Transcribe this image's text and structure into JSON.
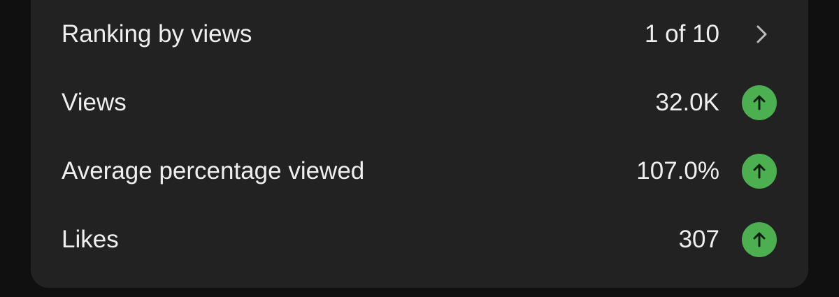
{
  "colors": {
    "background": "#101010",
    "card": "#222222",
    "text": "#efefef",
    "up_badge": "#4caf50",
    "up_arrow": "#0d1f0f"
  },
  "rows": [
    {
      "label": "Ranking by views",
      "value": "1 of 10",
      "icon": "chevron-right-icon"
    },
    {
      "label": "Views",
      "value": "32.0K",
      "icon": "arrow-up-circle-icon"
    },
    {
      "label": "Average percentage viewed",
      "value": "107.0%",
      "icon": "arrow-up-circle-icon"
    },
    {
      "label": "Likes",
      "value": "307",
      "icon": "arrow-up-circle-icon"
    }
  ]
}
